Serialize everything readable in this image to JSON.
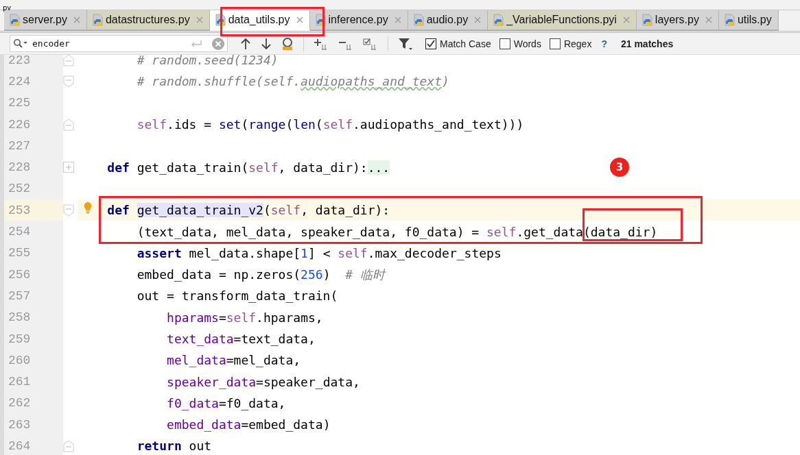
{
  "top_strip": {
    "text": "py"
  },
  "tabs": [
    {
      "label": "server.py",
      "selected": false,
      "color": "#d4d4d4",
      "closable": true
    },
    {
      "label": "datastructures.py",
      "selected": false,
      "color": "#d6d5bf",
      "closable": true
    },
    {
      "label": "data_utils.py",
      "selected": true,
      "color": "#ffffff",
      "closable": true
    },
    {
      "label": "inference.py",
      "selected": false,
      "color": "#d4d4d4",
      "closable": true
    },
    {
      "label": "audio.py",
      "selected": false,
      "color": "#d4d4d4",
      "closable": true
    },
    {
      "label": "_VariableFunctions.pyi",
      "selected": false,
      "color": "#d6d5bf",
      "closable": true
    },
    {
      "label": "layers.py",
      "selected": false,
      "color": "#d4d4d4",
      "closable": true
    },
    {
      "label": "utils.py",
      "selected": false,
      "color": "#d4d4d4",
      "closable": false
    }
  ],
  "find_bar": {
    "value": "encoder",
    "options": [
      {
        "label": "Match Case",
        "checked": true
      },
      {
        "label": "Words",
        "checked": false
      },
      {
        "label": "Regex",
        "checked": false
      }
    ],
    "help": "?",
    "matches": "21 matches"
  },
  "lines": [
    {
      "number": "223",
      "current": false,
      "kind": "fold_end",
      "intention": false,
      "tokens": [
        {
          "text": "        # random.seed(1234)",
          "kind": "comment"
        }
      ]
    },
    {
      "number": "224",
      "current": false,
      "kind": "fold_start",
      "intention": false,
      "tokens": [
        {
          "text": "        # random.shuffle(self.",
          "kind": "comment"
        },
        {
          "text": "audiopaths_and_text",
          "kind": "typo"
        },
        {
          "text": ")",
          "kind": "comment"
        }
      ]
    },
    {
      "number": "225",
      "current": false,
      "kind": "plain",
      "intention": false
    },
    {
      "number": "226",
      "current": false,
      "kind": "fold_end",
      "intention": false,
      "tokens": [
        {
          "text": "        self",
          "kind": "self"
        },
        {
          "text": ".ids = ",
          "kind": "plain"
        },
        {
          "text": "set",
          "kind": "builtin"
        },
        {
          "text": "(",
          "kind": "plain"
        },
        {
          "text": "range",
          "kind": "builtin"
        },
        {
          "text": "(",
          "kind": "plain"
        },
        {
          "text": "len",
          "kind": "builtin"
        },
        {
          "text": "(",
          "kind": "plain"
        },
        {
          "text": "self",
          "kind": "self"
        },
        {
          "text": ".audiopaths_and_text)))",
          "kind": "plain"
        }
      ]
    },
    {
      "number": "227",
      "current": false,
      "kind": "plain",
      "intention": false
    },
    {
      "number": "228",
      "current": false,
      "kind": "collapsed",
      "intention": false,
      "tokens": [
        {
          "text": "    def",
          "kind": "kw"
        },
        {
          "text": " get_data_train(",
          "kind": "plain"
        },
        {
          "text": "self",
          "kind": "self"
        },
        {
          "text": ", data_dir):",
          "kind": "plain"
        },
        {
          "text": "...",
          "kind": "folded"
        }
      ]
    },
    {
      "number": "252",
      "current": false,
      "kind": "plain",
      "intention": false
    },
    {
      "number": "253",
      "current": true,
      "kind": "fold_start",
      "intention": true,
      "tokens": [
        {
          "text": "    def ",
          "kind": "kw"
        },
        {
          "text": "get_data_train_v2",
          "kind": "usage"
        },
        {
          "text": "(",
          "kind": "plain"
        },
        {
          "text": "self",
          "kind": "self"
        },
        {
          "text": ", data_dir):",
          "kind": "plain"
        }
      ]
    },
    {
      "number": "254",
      "current": false,
      "kind": "plain",
      "intention": false,
      "tokens": [
        {
          "text": "        (text_data, mel_data, speaker_data, f0_data) = ",
          "kind": "plain"
        },
        {
          "text": "self",
          "kind": "self"
        },
        {
          "text": ".get_data(data_dir)",
          "kind": "plain"
        }
      ]
    },
    {
      "number": "255",
      "current": false,
      "kind": "plain",
      "intention": false,
      "tokens": [
        {
          "text": "        assert",
          "kind": "kw"
        },
        {
          "text": " mel_data.shape[",
          "kind": "plain"
        },
        {
          "text": "1",
          "kind": "num"
        },
        {
          "text": "] < ",
          "kind": "plain"
        },
        {
          "text": "self",
          "kind": "self"
        },
        {
          "text": ".max_decoder_steps",
          "kind": "plain"
        }
      ]
    },
    {
      "number": "256",
      "current": false,
      "kind": "plain",
      "intention": false,
      "tokens": [
        {
          "text": "        embed_data = np.zeros(",
          "kind": "plain"
        },
        {
          "text": "256",
          "kind": "num"
        },
        {
          "text": ")  ",
          "kind": "plain"
        },
        {
          "text": "# 临时",
          "kind": "comment"
        }
      ]
    },
    {
      "number": "257",
      "current": false,
      "kind": "plain",
      "intention": false,
      "tokens": [
        {
          "text": "        out = transform_data_train(",
          "kind": "plain"
        }
      ]
    },
    {
      "number": "258",
      "current": false,
      "kind": "plain",
      "intention": false,
      "tokens": [
        {
          "text": "            hparams",
          "kind": "param"
        },
        {
          "text": "=",
          "kind": "plain"
        },
        {
          "text": "self",
          "kind": "self"
        },
        {
          "text": ".hparams,",
          "kind": "plain"
        }
      ]
    },
    {
      "number": "259",
      "current": false,
      "kind": "plain",
      "intention": false,
      "tokens": [
        {
          "text": "            text_data",
          "kind": "param"
        },
        {
          "text": "=text_data,",
          "kind": "plain"
        }
      ]
    },
    {
      "number": "260",
      "current": false,
      "kind": "plain",
      "intention": false,
      "tokens": [
        {
          "text": "            mel_data",
          "kind": "param"
        },
        {
          "text": "=mel_data,",
          "kind": "plain"
        }
      ]
    },
    {
      "number": "261",
      "current": false,
      "kind": "plain",
      "intention": false,
      "tokens": [
        {
          "text": "            speaker_data",
          "kind": "param"
        },
        {
          "text": "=speaker_data,",
          "kind": "plain"
        }
      ]
    },
    {
      "number": "262",
      "current": false,
      "kind": "plain",
      "intention": false,
      "tokens": [
        {
          "text": "            f0_data",
          "kind": "param"
        },
        {
          "text": "=f0_data,",
          "kind": "plain"
        }
      ]
    },
    {
      "number": "263",
      "current": false,
      "kind": "plain",
      "intention": false,
      "tokens": [
        {
          "text": "            embed_data",
          "kind": "param"
        },
        {
          "text": "=embed_data)",
          "kind": "plain"
        }
      ]
    },
    {
      "number": "264",
      "current": false,
      "kind": "fold_end",
      "intention": false,
      "tokens": [
        {
          "text": "        return",
          "kind": "kw"
        },
        {
          "text": " out",
          "kind": "plain"
        }
      ]
    }
  ],
  "annotations": [
    {
      "kind": "tab_box"
    },
    {
      "kind": "block_box"
    },
    {
      "kind": "argument_box"
    },
    {
      "kind": "badge",
      "text": "3"
    }
  ]
}
